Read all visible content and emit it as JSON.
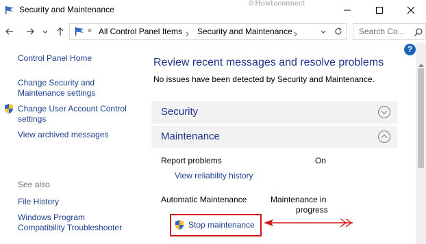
{
  "window": {
    "title": "Security and Maintenance",
    "watermark": "©Howtoconnect"
  },
  "addressbar": {
    "overflow": "«",
    "crumbs": [
      "All Control Panel Items",
      "Security and Maintenance"
    ],
    "search_placeholder": "Search Co..."
  },
  "help_label": "?",
  "sidebar": {
    "home": "Control Panel Home",
    "change_security_1": "Change Security and",
    "change_security_2": "Maintenance settings",
    "change_uac_1": "Change User Account Control",
    "change_uac_2": "settings",
    "archived": "View archived messages",
    "see_also": "See also",
    "file_history": "File History",
    "compat_1": "Windows Program",
    "compat_2": "Compatibility Troubleshooter"
  },
  "main": {
    "heading": "Review recent messages and resolve problems",
    "status": "No issues have been detected by Security and Maintenance.",
    "sections": {
      "security": "Security",
      "maintenance": "Maintenance"
    },
    "report_problems": {
      "label": "Report problems",
      "value": "On",
      "link": "View reliability history"
    },
    "automatic_maintenance": {
      "label": "Automatic Maintenance",
      "value_1": "Maintenance in",
      "value_2": "progress",
      "action": "Stop maintenance"
    }
  },
  "colors": {
    "link": "#1c3f8f",
    "heading": "#1e3287",
    "highlight": "#d11414"
  }
}
